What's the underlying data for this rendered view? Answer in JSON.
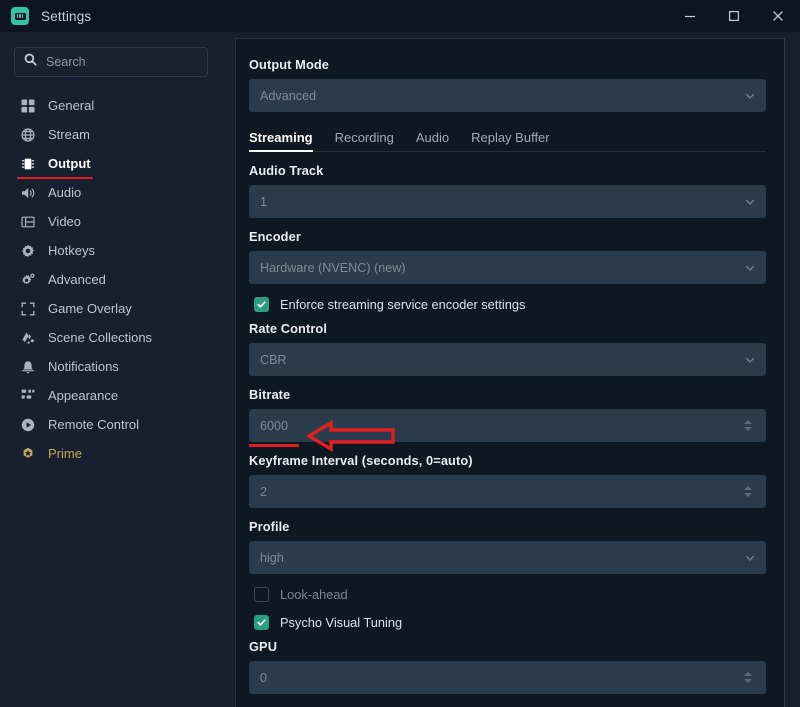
{
  "window": {
    "title": "Settings",
    "app_icon": "streamlabs-icon",
    "controls": {
      "minimize": "minimize-icon",
      "maximize": "maximize-icon",
      "close": "close-icon"
    }
  },
  "sidebar": {
    "search": {
      "placeholder": "Search",
      "value": "",
      "icon": "search-icon"
    },
    "items": [
      {
        "label": "General",
        "icon": "grid-icon",
        "active": false
      },
      {
        "label": "Stream",
        "icon": "globe-icon",
        "active": false
      },
      {
        "label": "Output",
        "icon": "chip-icon",
        "active": true
      },
      {
        "label": "Audio",
        "icon": "speaker-icon",
        "active": false
      },
      {
        "label": "Video",
        "icon": "video-icon",
        "active": false
      },
      {
        "label": "Hotkeys",
        "icon": "gear-icon",
        "active": false
      },
      {
        "label": "Advanced",
        "icon": "gears-icon",
        "active": false
      },
      {
        "label": "Game Overlay",
        "icon": "expand-icon",
        "active": false
      },
      {
        "label": "Scene Collections",
        "icon": "layers-icon",
        "active": false
      },
      {
        "label": "Notifications",
        "icon": "bell-icon",
        "active": false
      },
      {
        "label": "Appearance",
        "icon": "appearance-icon",
        "active": false
      },
      {
        "label": "Remote Control",
        "icon": "play-circle-icon",
        "active": false
      },
      {
        "label": "Prime",
        "icon": "prime-star-icon",
        "active": false
      }
    ]
  },
  "main": {
    "output_mode": {
      "label": "Output Mode",
      "value": "Advanced",
      "chevron": "chevron-down-icon"
    },
    "tabs": [
      {
        "label": "Streaming",
        "active": true
      },
      {
        "label": "Recording",
        "active": false
      },
      {
        "label": "Audio",
        "active": false
      },
      {
        "label": "Replay Buffer",
        "active": false
      }
    ],
    "audio_track": {
      "label": "Audio Track",
      "value": "1",
      "chevron": "chevron-down-icon"
    },
    "encoder": {
      "label": "Encoder",
      "value": "Hardware (NVENC) (new)",
      "chevron": "chevron-down-icon"
    },
    "enforce": {
      "label": "Enforce streaming service encoder settings",
      "checked": true
    },
    "rate_control": {
      "label": "Rate Control",
      "value": "CBR",
      "chevron": "chevron-down-icon"
    },
    "bitrate": {
      "label": "Bitrate",
      "value": "6000"
    },
    "keyframe": {
      "label": "Keyframe Interval (seconds, 0=auto)",
      "value": "2"
    },
    "profile": {
      "label": "Profile",
      "value": "high",
      "chevron": "chevron-down-icon"
    },
    "look_ahead": {
      "label": "Look-ahead",
      "checked": false
    },
    "psycho": {
      "label": "Psycho Visual Tuning",
      "checked": true
    },
    "gpu": {
      "label": "GPU",
      "value": "0"
    }
  },
  "annotations": {
    "accent_color": "#e02020",
    "arrow": "left-arrow-annotation",
    "underline_output": "output-underline-annotation",
    "underline_bitrate": "bitrate-underline-annotation"
  },
  "colors": {
    "sidebar_bg": "#16202e",
    "panel_bg": "#0e1822",
    "titlebar_bg": "#0c141f",
    "input_bg": "#2a3b4b",
    "accent_green": "#2a9e82",
    "prime_gold": "#c9a557",
    "annotation_red": "#e02020"
  }
}
